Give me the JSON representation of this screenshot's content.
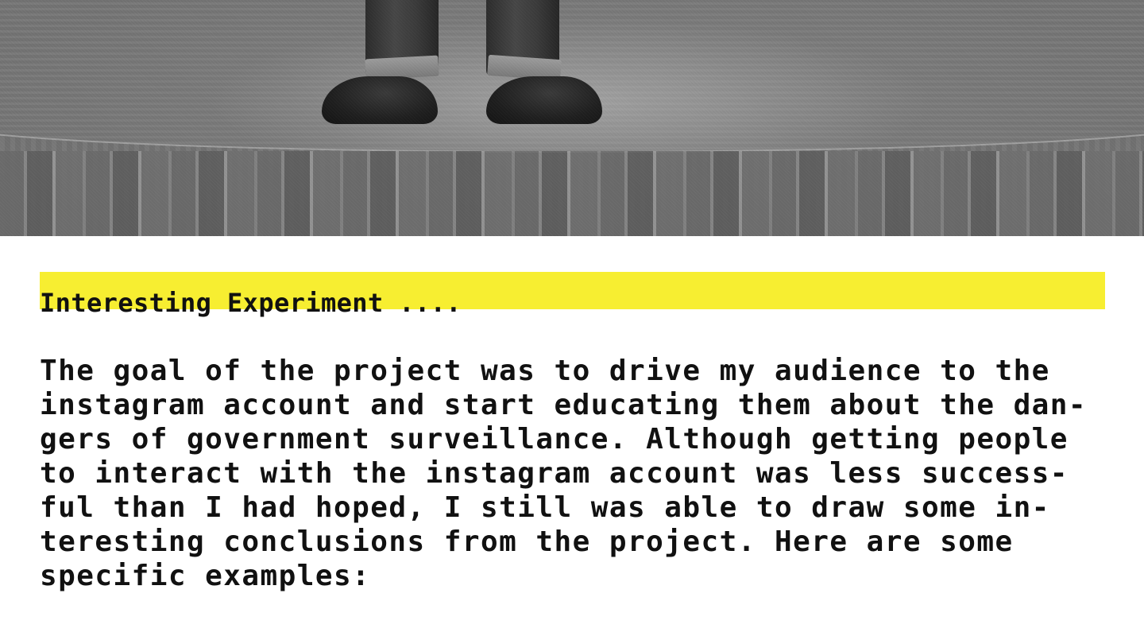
{
  "photo": {
    "subject": "black and white photo of a person's boots standing on a wooden floor"
  },
  "article": {
    "heading": "Interesting Experiment ....",
    "body_lines": [
      "The goal of the project was to drive my audience to the",
      "instagram account and start educating them about the dan-",
      "gers of government surveillance. Although getting people",
      "to interact with the instagram account was less success-",
      "ful than I had hoped, I still was able to draw some in-",
      "teresting conclusions from the project. Here are some",
      "specific examples:"
    ]
  },
  "colors": {
    "highlight": "#f7ee31",
    "text": "#111111",
    "background": "#ffffff"
  }
}
